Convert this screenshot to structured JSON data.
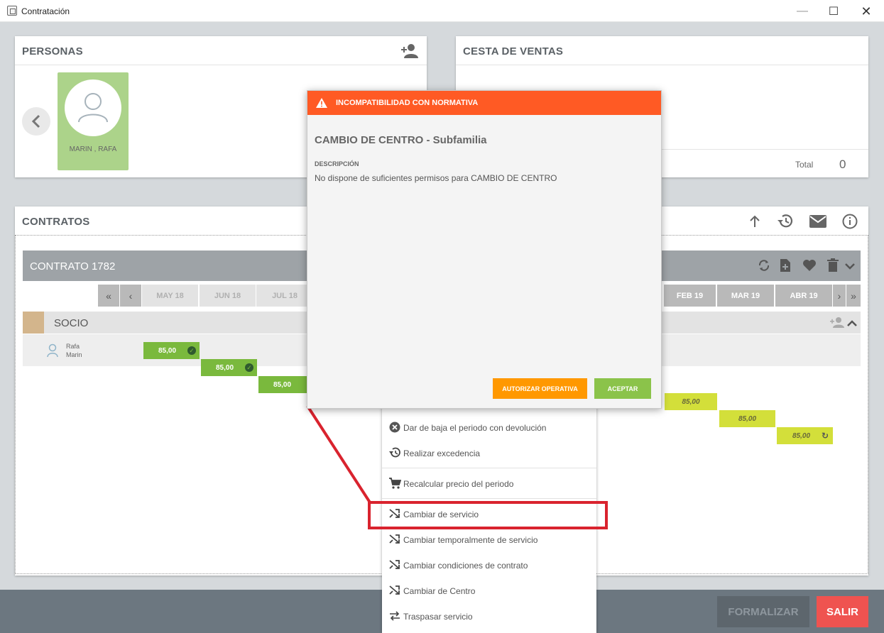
{
  "window": {
    "title": "Contratación",
    "minimize": "—",
    "maximize": "☐",
    "close": "✕"
  },
  "personas": {
    "title": "PERSONAS",
    "add_icon": "add-person-icon",
    "person_name": "MARIN , RAFA"
  },
  "cesta": {
    "title": "CESTA DE VENTAS",
    "total_label": "Total",
    "total_value": "0"
  },
  "contratos": {
    "title": "CONTRATOS",
    "contract_label": "CONTRATO 1782",
    "months_left": [
      "MAY 18",
      "JUN 18",
      "JUL 18"
    ],
    "months_right": [
      "FEB 19",
      "MAR 19",
      "ABR 19"
    ],
    "nav_first": "«",
    "nav_prev": "‹",
    "nav_next": "›",
    "nav_last": "»",
    "section": "SOCIO",
    "member_first": "Rafa",
    "member_last": "Marin",
    "left_values": [
      "85,00",
      "85,00",
      "85,00"
    ],
    "right_values": [
      "85,00",
      "85,00",
      "85,00"
    ]
  },
  "modal": {
    "header": "INCOMPATIBILIDAD CON NORMATIVA",
    "subtitle": "CAMBIO DE CENTRO - Subfamilia",
    "desc_label": "DESCRIPCIÓN",
    "desc_text": "No dispone de suficientes permisos para CAMBIO DE CENTRO",
    "btn_authorize": "AUTORIZAR OPERATIVA",
    "btn_accept": "ACEPTAR"
  },
  "menu": {
    "items": [
      {
        "label": "Dar de baja el periodo con devolución",
        "icon": "cancel-circle-icon"
      },
      {
        "label": "Realizar excedencia",
        "icon": "history-icon"
      },
      {
        "label": "Recalcular precio del periodo",
        "icon": "cart-icon"
      },
      {
        "label": "Cambiar de servicio",
        "icon": "shuffle-icon"
      },
      {
        "label": "Cambiar temporalmente de servicio",
        "icon": "shuffle-icon"
      },
      {
        "label": "Cambiar condiciones de contrato",
        "icon": "shuffle-icon"
      },
      {
        "label": "Cambiar de Centro",
        "icon": "shuffle-icon"
      },
      {
        "label": "Traspasar servicio",
        "icon": "swap-icon"
      }
    ]
  },
  "footer": {
    "formalizar": "FORMALIZAR",
    "salir": "SALIR"
  },
  "colors": {
    "modal_header": "#ff5a24",
    "authorize": "#ff9800",
    "accept": "#8bc34a",
    "paid": "#7ab93d",
    "pending": "#d3df3a",
    "highlight": "#d9232e",
    "salir": "#ef5350"
  }
}
